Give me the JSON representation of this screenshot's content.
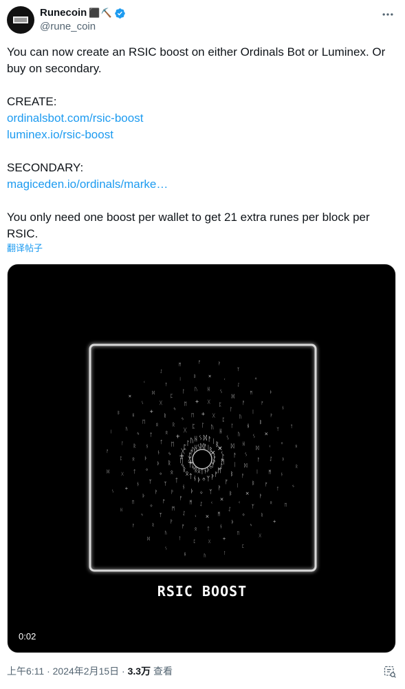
{
  "author": {
    "name": "Runecoin",
    "flag_emoji": "⬛",
    "pick_emoji": "⛏️",
    "handle": "@rune_coin",
    "verified_color": "#1d9bf0"
  },
  "tweet": {
    "line1": "You can now create an RSIC boost on either Ordinals Bot or Luminex. Or buy on secondary.",
    "create_label": "CREATE:",
    "create_link1": "ordinalsbot.com/rsic-boost",
    "create_link2": "luminex.io/rsic-boost",
    "secondary_label": "SECONDARY:",
    "secondary_link": "magiceden.io/ordinals/marke…",
    "line_last": "You only need one boost per wallet to get 21 extra runes per block per RSIC.",
    "translate_label": "翻译帖子"
  },
  "media": {
    "title": "RSIC BOOST",
    "timer": "0:02"
  },
  "footer": {
    "time": "上午6:11 · 2024年2月15日 · ",
    "views_count": "3.3万",
    "views_label": " 查看"
  },
  "icons": {
    "more": "more-icon",
    "verified": "verified-badge-icon",
    "analytics": "analytics-icon"
  },
  "colors": {
    "link": "#1d9bf0",
    "secondary_text": "#536471"
  }
}
